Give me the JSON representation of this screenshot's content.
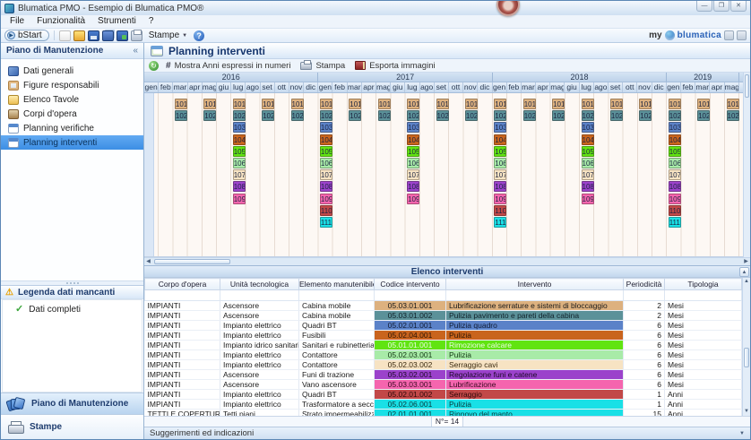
{
  "window": {
    "title": "Blumatica PMO - Esempio di Blumatica PMO®",
    "controls": {
      "minimize": "—",
      "maximize": "❐",
      "close": "✕"
    }
  },
  "menu": {
    "items": [
      "File",
      "Funzionalità",
      "Strumenti",
      "?"
    ]
  },
  "toolbar": {
    "bstart_label": "bStart",
    "bstart_glyph": "▶",
    "stampe_label": "Stampe",
    "stampe_caret": "▼",
    "help_glyph": "?",
    "brand": {
      "prefix": "my",
      "name": "blumatica"
    }
  },
  "sidebar": {
    "header": "Piano di Manutenzione",
    "collapse_glyph": "«",
    "items": [
      {
        "label": "Dati generali",
        "icon": "dati-generali-icon",
        "selected": false
      },
      {
        "label": "Figure responsabili",
        "icon": "figure-responsabili-icon",
        "selected": false
      },
      {
        "label": "Elenco Tavole",
        "icon": "elenco-tavole-icon",
        "selected": false
      },
      {
        "label": "Corpi d'opera",
        "icon": "corpi-dopera-icon",
        "selected": false
      },
      {
        "label": "Planning verifiche",
        "icon": "planning-verifiche-icon",
        "selected": false
      },
      {
        "label": "Planning interventi",
        "icon": "planning-interventi-icon",
        "selected": true
      }
    ],
    "legend": {
      "header": "Legenda dati mancanti",
      "warn_glyph": "⚠",
      "items": [
        {
          "label": "Dati completi",
          "check_glyph": "✓"
        }
      ]
    },
    "nav": [
      {
        "label": "Piano di Manutenzione",
        "icon": "plan-fan-icon",
        "active": true
      },
      {
        "label": "Stampe",
        "icon": "printer-icon",
        "active": false
      }
    ]
  },
  "main": {
    "title": "Planning interventi",
    "toolbar": {
      "refresh_glyph": "↻",
      "hash_glyph": "#",
      "show_numbers_label": "Mostra Anni espressi in numeri",
      "print_label": "Stampa",
      "export_label": "Esporta immagini"
    }
  },
  "planning": {
    "years": [
      {
        "label": "2016",
        "months": 12
      },
      {
        "label": "2017",
        "months": 12
      },
      {
        "label": "2018",
        "months": 12
      },
      {
        "label": "2019",
        "months": 5
      }
    ],
    "month_labels": [
      "gen",
      "feb",
      "mar",
      "apr",
      "mag",
      "giu",
      "lug",
      "ago",
      "set",
      "ott",
      "nov",
      "dic"
    ],
    "codes": [
      {
        "code": "101",
        "color": "#ddb17f",
        "start": 2,
        "every": 2
      },
      {
        "code": "102",
        "color": "#5b9199",
        "start": 2,
        "every": 2
      },
      {
        "code": "103",
        "color": "#5b82c8",
        "start": 6,
        "every": 6
      },
      {
        "code": "104",
        "color": "#c9641d",
        "start": 6,
        "every": 6
      },
      {
        "code": "105",
        "color": "#61e411",
        "start": 6,
        "every": 6
      },
      {
        "code": "106",
        "color": "#a8eba8",
        "start": 6,
        "every": 6
      },
      {
        "code": "107",
        "color": "#f7e3c3",
        "start": 6,
        "every": 6
      },
      {
        "code": "108",
        "color": "#9b42cb",
        "start": 6,
        "every": 6
      },
      {
        "code": "109",
        "color": "#f565ae",
        "start": 6,
        "every": 6
      },
      {
        "code": "110",
        "color": "#c24848",
        "start": 12,
        "every": 12
      },
      {
        "code": "111",
        "color": "#19e0e6",
        "start": 12,
        "every": 12
      }
    ]
  },
  "table": {
    "title": "Elenco interventi",
    "columns": [
      "Corpo d'opera",
      "Unità tecnologica",
      "Elemento manutenibile",
      "Codice intervento",
      "Intervento",
      "Periodicità",
      "Tipologia"
    ],
    "rows": [
      {
        "corpo": "IMPIANTI",
        "unita": "Ascensore",
        "elemento": "Cabina mobile",
        "codice": "05.03.01.001",
        "intervento": "Lubrificazione serrature e sistemi di bloccaggio",
        "periodicita": "2",
        "tipologia": "Mesi",
        "color": "#ddb17f",
        "text": "#1a1a1a"
      },
      {
        "corpo": "IMPIANTI",
        "unita": "Ascensore",
        "elemento": "Cabina mobile",
        "codice": "05.03.01.002",
        "intervento": "Pulizia pavimento e pareti della cabina",
        "periodicita": "2",
        "tipologia": "Mesi",
        "color": "#5b9199",
        "text": "#10222a"
      },
      {
        "corpo": "IMPIANTI",
        "unita": "Impianto elettrico",
        "elemento": "Quadri BT",
        "codice": "05.02.01.001",
        "intervento": "Pulizia quadro",
        "periodicita": "6",
        "tipologia": "Mesi",
        "color": "#5b82c8",
        "text": "#101c36"
      },
      {
        "corpo": "IMPIANTI",
        "unita": "Impianto elettrico",
        "elemento": "Fusibili",
        "codice": "05.02.04.001",
        "intervento": "Pulizia",
        "periodicita": "6",
        "tipologia": "Mesi",
        "color": "#c9641d",
        "text": "#2e1504"
      },
      {
        "corpo": "IMPIANTI",
        "unita": "Impianto idrico sanitario",
        "elemento": "Sanitari e rubinetteria",
        "codice": "05.01.01.001",
        "intervento": "Rimozione calcare",
        "periodicita": "6",
        "tipologia": "Mesi",
        "color": "#61e411",
        "text": "#eafce2"
      },
      {
        "corpo": "IMPIANTI",
        "unita": "Impianto elettrico",
        "elemento": "Contattore",
        "codice": "05.02.03.001",
        "intervento": "Pulizia",
        "periodicita": "6",
        "tipologia": "Mesi",
        "color": "#a8eba8",
        "text": "#123812"
      },
      {
        "corpo": "IMPIANTI",
        "unita": "Impianto elettrico",
        "elemento": "Contattore",
        "codice": "05.02.03.002",
        "intervento": "Serraggio cavi",
        "periodicita": "6",
        "tipologia": "Mesi",
        "color": "#f7e3c3",
        "text": "#3a2a10"
      },
      {
        "corpo": "IMPIANTI",
        "unita": "Ascensore",
        "elemento": "Funi di trazione",
        "codice": "05.03.02.001",
        "intervento": "Regolazione funi e catene",
        "periodicita": "6",
        "tipologia": "Mesi",
        "color": "#9b42cb",
        "text": "#1e0a2a"
      },
      {
        "corpo": "IMPIANTI",
        "unita": "Ascensore",
        "elemento": "Vano ascensore",
        "codice": "05.03.03.001",
        "intervento": "Lubrificazione",
        "periodicita": "6",
        "tipologia": "Mesi",
        "color": "#f565ae",
        "text": "#3a0a22"
      },
      {
        "corpo": "IMPIANTI",
        "unita": "Impianto elettrico",
        "elemento": "Quadri BT",
        "codice": "05.02.01.002",
        "intervento": "Serraggio",
        "periodicita": "1",
        "tipologia": "Anni",
        "color": "#c24848",
        "text": "#2e0808"
      },
      {
        "corpo": "IMPIANTI",
        "unita": "Impianto elettrico",
        "elemento": "Trasformatore a secco",
        "codice": "05.02.06.001",
        "intervento": "Pulizia",
        "periodicita": "1",
        "tipologia": "Anni",
        "color": "#19e0e6",
        "text": "#083a3c"
      },
      {
        "corpo": "TETTI E COPERTURE",
        "unita": "Tetti piani",
        "elemento": "Strato impermeabilizzazione...",
        "codice": "02.01.01.001",
        "intervento": "Rinnovo del manto",
        "periodicita": "15",
        "tipologia": "Anni",
        "color": "#19e0e6",
        "text": "#083a3c"
      }
    ],
    "footer": "N°= 14"
  },
  "statusbar": {
    "text": "Suggerimenti ed indicazioni"
  }
}
